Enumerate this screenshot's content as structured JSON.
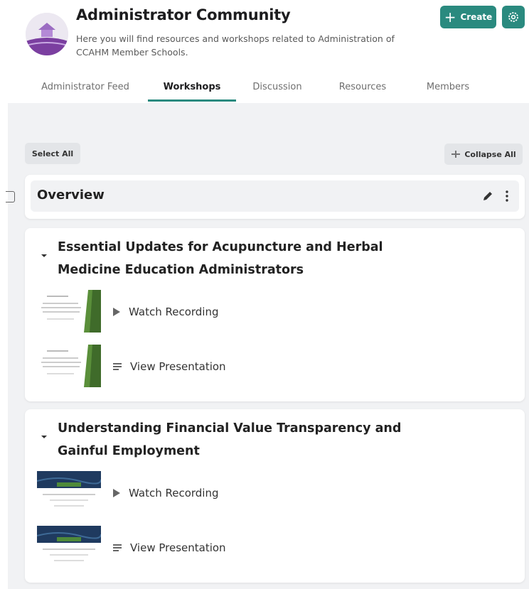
{
  "header": {
    "title": "Administrator Community",
    "description": "Here you will find resources and workshops related to Administration of CCAHM Member Schools.",
    "create_label": "Create",
    "avatar_icon": "community-logo-icon",
    "settings_icon": "gear-icon"
  },
  "tabs": [
    {
      "label": "Administrator Feed"
    },
    {
      "label": "Workshops",
      "active": true
    },
    {
      "label": "Discussion"
    },
    {
      "label": "Resources"
    },
    {
      "label": "Members"
    }
  ],
  "toolbar": {
    "select_all_label": "Select All",
    "collapse_all_label": "Collapse All"
  },
  "overview": {
    "title": "Overview"
  },
  "workshops": [
    {
      "title": "Essential Updates for Acupuncture and Herbal Medicine Education Administrators",
      "items": [
        {
          "label": "Watch Recording",
          "icon": "play-icon"
        },
        {
          "label": "View Presentation",
          "icon": "list-icon"
        }
      ]
    },
    {
      "title": "Understanding Financial Value Transparency and Gainful Employment",
      "items": [
        {
          "label": "Watch Recording",
          "icon": "play-icon"
        },
        {
          "label": "View Presentation",
          "icon": "list-icon"
        }
      ]
    }
  ],
  "colors": {
    "accent": "#2a8a7f",
    "avatar_purple": "#7b3fa0",
    "thumb_green": "#5a8f3a",
    "thumb_navy": "#1f3a5f"
  }
}
